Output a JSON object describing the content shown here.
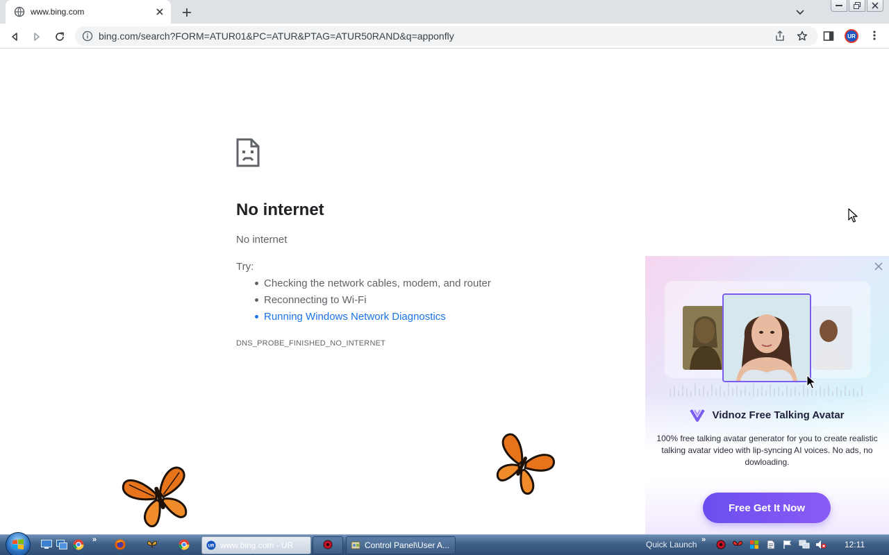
{
  "browser": {
    "tab": {
      "title": "www.bing.com"
    },
    "address": {
      "url": "bing.com/search?FORM=ATUR01&PC=ATUR&PTAG=ATUR50RAND&q=apponfly"
    },
    "profile_initials": "UR"
  },
  "error_page": {
    "title": "No internet",
    "subtitle": "No internet",
    "try_label": "Try:",
    "suggestions": [
      {
        "text": "Checking the network cables, modem, and router",
        "link": false
      },
      {
        "text": "Reconnecting to Wi-Fi",
        "link": false
      },
      {
        "text": "Running Windows Network Diagnostics",
        "link": true
      }
    ],
    "error_code": "DNS_PROBE_FINISHED_NO_INTERNET"
  },
  "ad": {
    "brand": "Vidnoz Free Talking Avatar",
    "description": "100% free talking avatar generator for you to create realistic talking avatar video with lip-syncing AI voices. No ads, no dowloading.",
    "cta": "Free Get It Now"
  },
  "taskbar": {
    "items": [
      {
        "label": "www.bing.com - UR",
        "state": "active"
      },
      {
        "label": "Control Panel\\User A...",
        "state": "normal"
      }
    ],
    "quick_launch_label": "Quick Launch",
    "clock": "12:11"
  },
  "colors": {
    "link": "#1a73e8",
    "ad_cta": "#6b4ef0",
    "taskbar": "#3e5f86"
  }
}
